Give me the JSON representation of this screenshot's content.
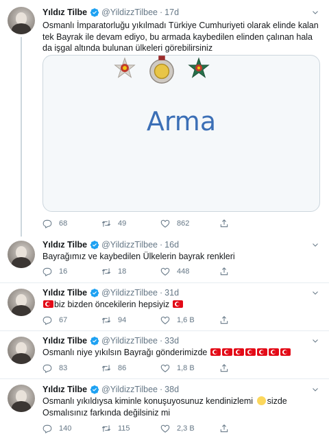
{
  "user": {
    "name": "Yıldız Tilbe",
    "handle": "@YildizzTilbee",
    "separator": "·"
  },
  "tweets": [
    {
      "time": "17d",
      "text": "Osmanlı İmparatorluğu yıkılmadı Türkiye Cumhuriyeti olarak elinde kalan tek Bayrak ile devam ediyo, bu armada kaybedilen elinden çalınan hala da işgal altında bulunan ülkeleri görebilirsiniz",
      "card_title": "Arma",
      "replies": "68",
      "retweets": "49",
      "likes": "862"
    },
    {
      "time": "16d",
      "text": "Bayrağımız ve kaybedilen Ülkelerin bayrak renkleri",
      "replies": "16",
      "retweets": "18",
      "likes": "448"
    },
    {
      "time": "31d",
      "text": "biz bizden öncekilerin hepsiyiz",
      "replies": "67",
      "retweets": "94",
      "likes": "1,6 B"
    },
    {
      "time": "33d",
      "text": "Osmanlı niye yıkılsın  Bayrağı gönderimizde",
      "replies": "83",
      "retweets": "86",
      "likes": "1,8 B"
    },
    {
      "time": "38d",
      "text_before": "Osmanlı yıkıldıysa kiminle konuşuyosunuz kendinizlemi",
      "text_after": "sizde Osmalısınız farkında değilsiniz mi",
      "replies": "140",
      "retweets": "115",
      "likes": "2,3 B"
    }
  ],
  "colors": {
    "accent": "#1da1f2",
    "muted": "#657786",
    "border": "#e6ecf0",
    "flag_red": "#e30a17"
  },
  "icons": [
    "verified-badge-icon",
    "chevron-down-icon",
    "reply-icon",
    "retweet-icon",
    "like-icon",
    "share-icon"
  ]
}
